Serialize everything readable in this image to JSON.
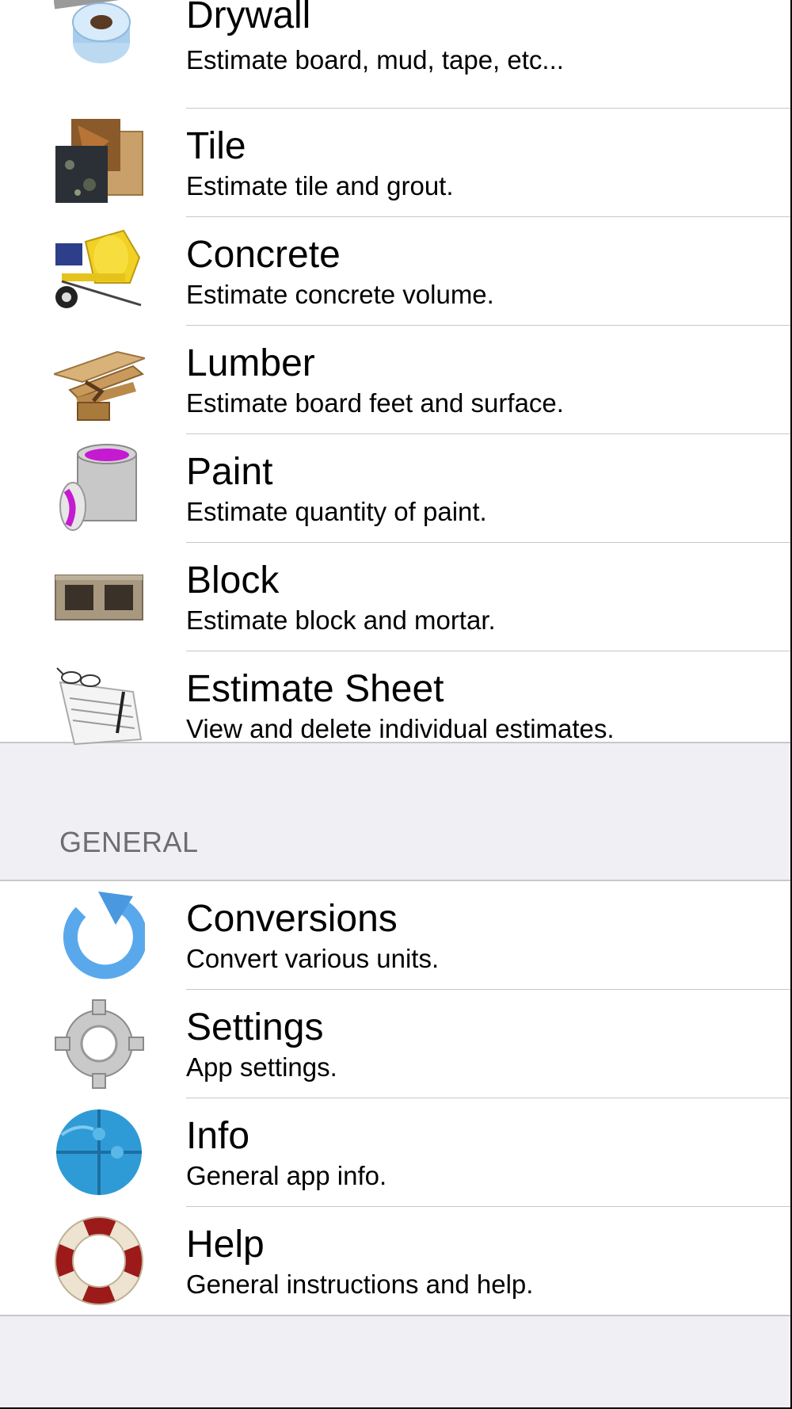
{
  "calculators": [
    {
      "title": "Drywall",
      "subtitle": "Estimate board, mud, tape, etc...",
      "icon": "drywall-tape-icon"
    },
    {
      "title": "Tile",
      "subtitle": "Estimate tile and grout.",
      "icon": "tile-samples-icon"
    },
    {
      "title": "Concrete",
      "subtitle": "Estimate concrete volume.",
      "icon": "cement-mixer-icon"
    },
    {
      "title": "Lumber",
      "subtitle": "Estimate board feet and surface.",
      "icon": "lumber-planks-icon"
    },
    {
      "title": "Paint",
      "subtitle": "Estimate quantity of paint.",
      "icon": "paint-can-icon"
    },
    {
      "title": "Block",
      "subtitle": "Estimate block and mortar.",
      "icon": "cinder-block-icon"
    },
    {
      "title": "Estimate Sheet",
      "subtitle": "View and delete individual estimates.",
      "icon": "estimate-sheet-icon"
    }
  ],
  "general_header": "GENERAL",
  "general": [
    {
      "title": "Conversions",
      "subtitle": "Convert various units.",
      "icon": "refresh-arrow-icon"
    },
    {
      "title": "Settings",
      "subtitle": "App settings.",
      "icon": "gear-icon"
    },
    {
      "title": "Info",
      "subtitle": "General app info.",
      "icon": "puzzle-globe-icon"
    },
    {
      "title": "Help",
      "subtitle": "General instructions and help.",
      "icon": "lifebuoy-icon"
    }
  ]
}
